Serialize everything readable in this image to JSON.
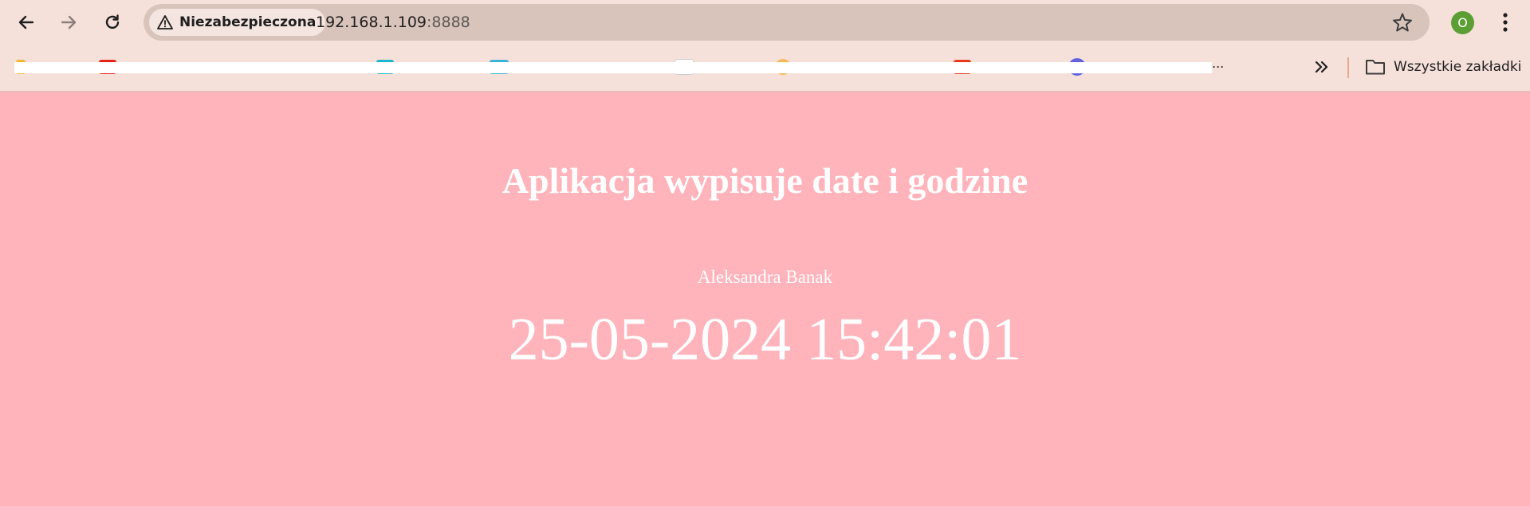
{
  "browser": {
    "security_label": "Niezabezpieczona",
    "url_host": "192.168.1.109",
    "url_port": ":8888",
    "profile_initial": "O",
    "all_bookmarks_label": "Wszystkie zakładki",
    "bookmarks_overflow": "...",
    "colors": {
      "toolbar_bg": "#f5e0da",
      "omnibox_bg": "#d9c4bc",
      "avatar_bg": "#5b9e33"
    }
  },
  "page": {
    "title": "Aplikacja wypisuje date i godzine",
    "author": "Aleksandra Banak",
    "datetime": "25-05-2024 15:42:01",
    "colors": {
      "background": "#ffb3bb",
      "text": "#ffffff"
    }
  }
}
